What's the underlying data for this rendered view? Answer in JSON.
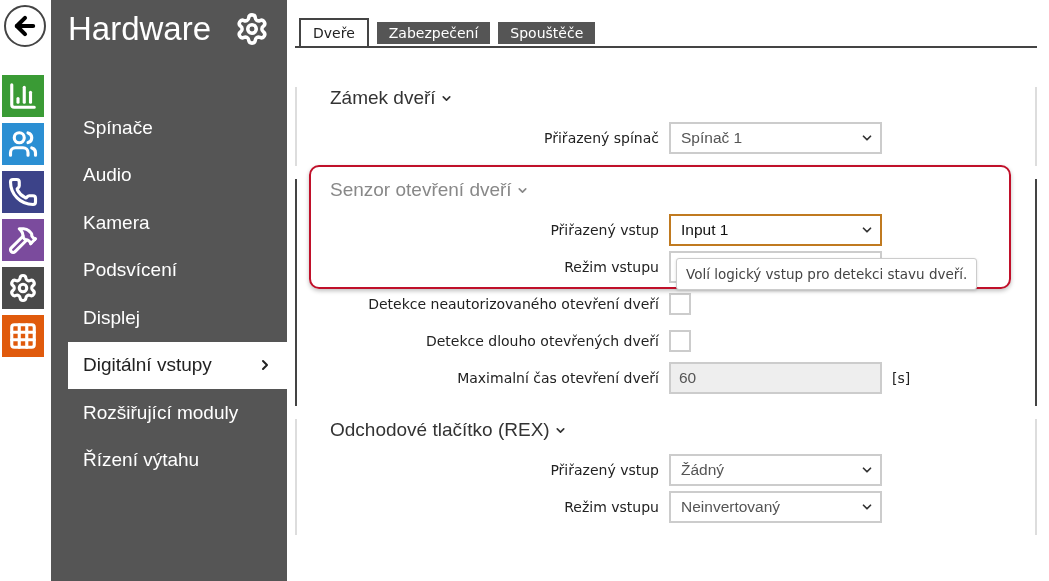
{
  "rail": {
    "items": [
      {
        "kind": "chart",
        "color": "#3a9b35"
      },
      {
        "kind": "users",
        "color": "#2b8fd3"
      },
      {
        "kind": "phone",
        "color": "#3c4389"
      },
      {
        "kind": "tools",
        "color": "#7b4b9d"
      },
      {
        "kind": "gear",
        "color": "#4a4a4a"
      },
      {
        "kind": "grid",
        "color": "#e05a0c"
      }
    ]
  },
  "sidebar": {
    "title": "Hardware",
    "items": [
      {
        "label": "Spínače",
        "selected": false
      },
      {
        "label": "Audio",
        "selected": false
      },
      {
        "label": "Kamera",
        "selected": false
      },
      {
        "label": "Podsvícení",
        "selected": false
      },
      {
        "label": "Displej",
        "selected": false
      },
      {
        "label": "Digitální vstupy",
        "selected": true
      },
      {
        "label": "Rozšiřující moduly",
        "selected": false
      },
      {
        "label": "Řízení výtahu",
        "selected": false
      }
    ]
  },
  "tabs": [
    {
      "label": "Dveře",
      "selected": true
    },
    {
      "label": "Zabezpečení",
      "selected": false
    },
    {
      "label": "Spouštěče",
      "selected": false
    }
  ],
  "sections": [
    {
      "title": "Zámek dveří",
      "active": false,
      "highlighted": false,
      "fields": [
        {
          "kind": "select",
          "label": "Přiřazený spínač",
          "value": "Spínač 1",
          "focused": false
        }
      ]
    },
    {
      "title": "Senzor otevření dveří",
      "active": true,
      "highlighted": true,
      "fields": [
        {
          "kind": "select",
          "label": "Přiřazený vstup",
          "value": "Input 1",
          "focused": true
        },
        {
          "kind": "select",
          "label": "Režim vstupu",
          "focused": false,
          "tooltip": "Volí logický vstup pro detekci stavu dveří."
        },
        {
          "kind": "checkbox",
          "label": "Detekce neautorizovaného otevření dveří",
          "checked": false
        },
        {
          "kind": "checkbox",
          "label": "Detekce dlouho otevřených dveří",
          "checked": false
        },
        {
          "kind": "number",
          "label": "Maximalní čas otevření dveří",
          "value": "60",
          "unit": "[s]",
          "disabled": true
        }
      ]
    },
    {
      "title": "Odchodové tlačítko (REX)",
      "active": false,
      "highlighted": false,
      "fields": [
        {
          "kind": "select",
          "label": "Přiřazený vstup",
          "value": "Žádný",
          "focused": false
        },
        {
          "kind": "select",
          "label": "Režim vstupu",
          "value": "Neinvertovaný",
          "focused": false
        }
      ]
    }
  ]
}
